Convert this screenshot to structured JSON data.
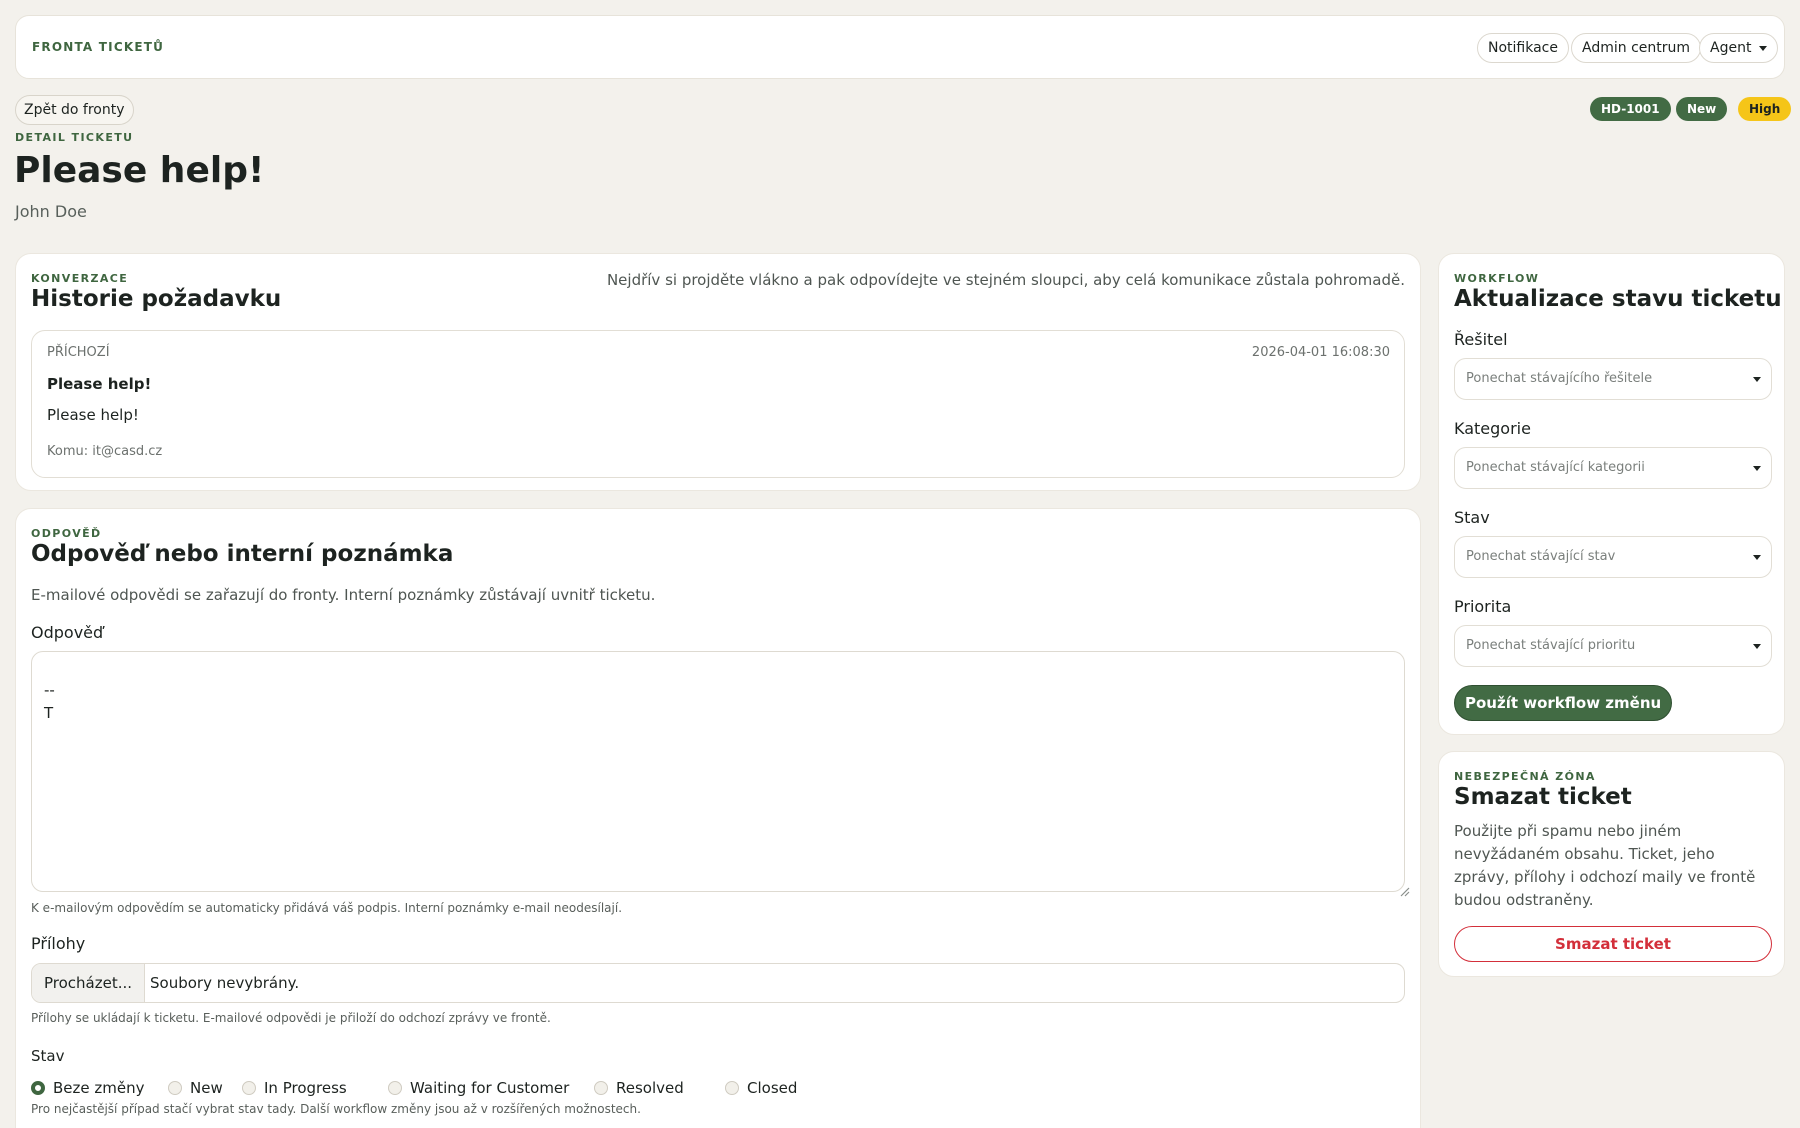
{
  "topbar": {
    "brand": "FRONTA TICKETŮ",
    "buttons": [
      "Notifikace",
      "Admin centrum",
      "Agent"
    ]
  },
  "header": {
    "back_label": "Zpět do fronty",
    "eyebrow": "DETAIL TICKETU",
    "title": "Please help!",
    "requester": "John Doe",
    "badges": [
      {
        "label": "HD-1001",
        "color": "#426b44"
      },
      {
        "label": "New",
        "color": "#426b44"
      },
      {
        "label": "High",
        "color": "#f5c518"
      }
    ]
  },
  "conversation": {
    "eyebrow": "KONVERZACE",
    "title": "Historie požadavku",
    "hint": "Nejdřív si projděte vlákno a pak odpovídejte ve stejném sloupci, aby celá komunikace zůstala pohromadě.",
    "message": {
      "direction": "PŘÍCHOZÍ",
      "timestamp": "2026-04-01 16:08:30",
      "subject": "Please help!",
      "body": "Please help!",
      "to": "Komu: it@casd.cz"
    }
  },
  "reply": {
    "eyebrow": "ODPOVĚĎ",
    "title": "Odpověď nebo interní poznámka",
    "description": "E-mailové odpovědi se zařazují do fronty. Interní poznámky zůstávají uvnitř ticketu.",
    "field_label": "Odpověď",
    "field_value": "--\nT",
    "signature_note": "K e-mailovým odpovědím se automaticky přidává váš podpis. Interní poznámky e-mail neodesílají.",
    "attachments_label": "Přílohy",
    "browse_label": "Procházet...",
    "no_files": "Soubory nevybrány.",
    "attachments_note": "Přílohy se ukládají k ticketu. E-mailové odpovědi je přiloží do odchozí zprávy ve frontě.",
    "status_label": "Stav",
    "status_options": [
      "Beze změny",
      "New",
      "In Progress",
      "Waiting for Customer",
      "Resolved",
      "Closed"
    ],
    "status_selected": "Beze změny",
    "status_note": "Pro nejčastější případ stačí vybrat stav tady. Další workflow změny jsou až v rozšířených možnostech."
  },
  "workflow": {
    "eyebrow": "WORKFLOW",
    "title": "Aktualizace stavu ticketu",
    "fields": [
      {
        "label": "Řešitel",
        "placeholder": "Ponechat stávajícího řešitele"
      },
      {
        "label": "Kategorie",
        "placeholder": "Ponechat stávající kategorii"
      },
      {
        "label": "Stav",
        "placeholder": "Ponechat stávající stav"
      },
      {
        "label": "Priorita",
        "placeholder": "Ponechat stávající prioritu"
      }
    ],
    "submit_label": "Použít workflow změnu"
  },
  "danger": {
    "eyebrow": "NEBEZPEČNÁ ZÓNA",
    "title": "Smazat ticket",
    "description": "Použijte při spamu nebo jiném nevyžádaném obsahu. Ticket, jeho zprávy, přílohy i odchozí maily ve frontě budou odstraněny.",
    "delete_label": "Smazat ticket"
  }
}
